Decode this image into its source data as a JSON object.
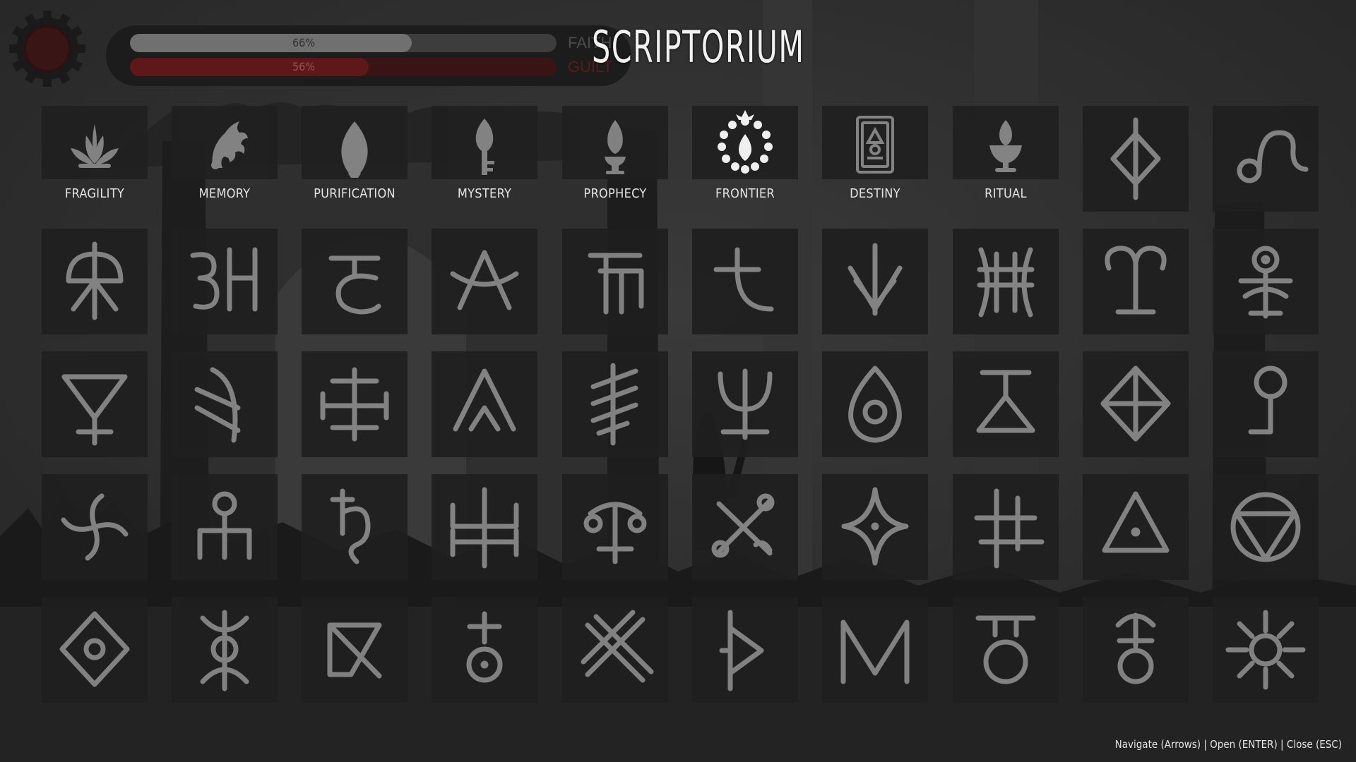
{
  "title": "SCRIPTORIUM",
  "hud": {
    "faith": {
      "label": "FAITH",
      "percent_text": "66%",
      "value": 0.66
    },
    "guilt": {
      "label": "GUILT",
      "percent_text": "56%",
      "value": 0.56
    }
  },
  "colors": {
    "background": "#2b2b2b",
    "tile": "#1f1f1f",
    "glyph": "#8a8a8a",
    "glyph_selected": "#ffffff",
    "guilt": "#5e1818"
  },
  "selected_index": 5,
  "glyphs": [
    {
      "name": "fragility-icon",
      "label": "FRAGILITY"
    },
    {
      "name": "memory-icon",
      "label": "MEMORY"
    },
    {
      "name": "purification-icon",
      "label": "PURIFICATION"
    },
    {
      "name": "mystery-icon",
      "label": "MYSTERY"
    },
    {
      "name": "prophecy-icon",
      "label": "PROPHECY"
    },
    {
      "name": "frontier-icon",
      "label": "FRONTIER"
    },
    {
      "name": "destiny-icon",
      "label": "DESTINY"
    },
    {
      "name": "ritual-icon",
      "label": "RITUAL"
    },
    {
      "name": "rune-diamond-cross-icon"
    },
    {
      "name": "rune-leo-icon"
    },
    {
      "name": "rune-parasol-icon"
    },
    {
      "name": "rune-three-h-icon"
    },
    {
      "name": "rune-t-c-icon"
    },
    {
      "name": "rune-crossed-a-icon"
    },
    {
      "name": "rune-gate-icon"
    },
    {
      "name": "rune-t-hook-icon"
    },
    {
      "name": "rune-arrow-down-icon"
    },
    {
      "name": "rune-bracket-bars-icon"
    },
    {
      "name": "rune-aries-icon"
    },
    {
      "name": "rune-mercury-icon"
    },
    {
      "name": "rune-funnel-icon"
    },
    {
      "name": "rune-angle-icon"
    },
    {
      "name": "rune-double-cross-icon"
    },
    {
      "name": "rune-chevron-icon"
    },
    {
      "name": "rune-slashed-bar-icon"
    },
    {
      "name": "rune-trident-icon"
    },
    {
      "name": "rune-eye-icon"
    },
    {
      "name": "rune-t-triangle-icon"
    },
    {
      "name": "rune-diamond-quartered-icon"
    },
    {
      "name": "rune-hook-circle-icon"
    },
    {
      "name": "rune-spiral-cross-icon"
    },
    {
      "name": "rune-figure-icon"
    },
    {
      "name": "rune-saturn-icon"
    },
    {
      "name": "rune-double-bracket-icon"
    },
    {
      "name": "rune-scales-icon"
    },
    {
      "name": "rune-crossed-circles-icon"
    },
    {
      "name": "rune-star-diamond-icon"
    },
    {
      "name": "rune-hash-icon"
    },
    {
      "name": "rune-triangle-dot-icon"
    },
    {
      "name": "rune-circle-triangle-icon"
    },
    {
      "name": "rune-diamond-dot-icon"
    },
    {
      "name": "rune-double-crescent-icon"
    },
    {
      "name": "rune-flag-icon"
    },
    {
      "name": "rune-t-circle-icon"
    },
    {
      "name": "rune-crosshatch-icon"
    },
    {
      "name": "rune-thorn-icon"
    },
    {
      "name": "rune-m-icon"
    },
    {
      "name": "rune-bar-circle-icon"
    },
    {
      "name": "rune-cross-circle-icon"
    },
    {
      "name": "rune-sun-icon"
    }
  ],
  "controls_hint": "Navigate (Arrows) | Open (ENTER) | Close (ESC)"
}
